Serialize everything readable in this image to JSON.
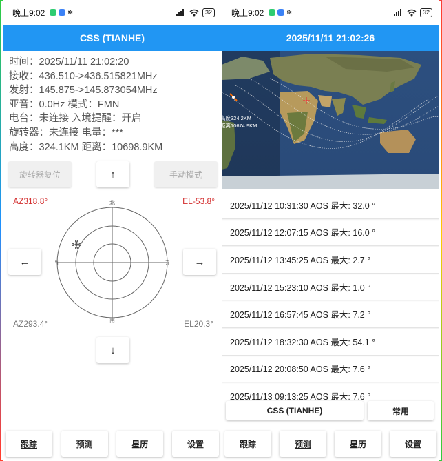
{
  "status": {
    "time": "晚上9:02",
    "battery": "32",
    "bluetooth": "✻",
    "signal_icon": "signal-icon",
    "wifi_icon": "wifi-icon"
  },
  "left": {
    "title": "CSS (TIANHE)",
    "info": [
      "时间：2025/11/11 21:02:20",
      "接收：436.510->436.515821MHz",
      "发射：145.875->145.873054MHz",
      "亚音：0.0Hz  模式：FMN",
      "电台：未连接  入境提醒：开启",
      "旋转器：未连接  电量：***",
      "高度：324.1KM  距离：10698.9KM"
    ],
    "rotator_reset": "旋转器复位",
    "up_arrow": "↑",
    "manual_mode": "手动模式",
    "az_current": "AZ318.8°",
    "el_current": "EL-53.8°",
    "left_arrow": "←",
    "right_arrow": "→",
    "down_arrow": "↓",
    "az_target": "AZ293.4°",
    "el_target": "EL20.3°",
    "compass": {
      "north": "北",
      "south": "南",
      "east": "东",
      "west": "西"
    },
    "sat_marker": "卫星"
  },
  "right": {
    "title": "2025/11/11 21:02:26",
    "map_label_height": "高度324.2KM",
    "map_label_distance": "距离10674.9KM",
    "passes": [
      "2025/11/12 10:31:30 AOS 最大:  32.0 °",
      "2025/11/12 12:07:15 AOS 最大:  16.0 °",
      "2025/11/12 13:45:25 AOS 最大:  2.7 °",
      "2025/11/12 15:23:10 AOS 最大:  1.0 °",
      "2025/11/12 16:57:45 AOS 最大:  7.2 °",
      "2025/11/12 18:32:30 AOS 最大:  54.1 °",
      "2025/11/12 20:08:50 AOS 最大:  7.6 °",
      "2025/11/13 09:13:25 AOS 最大:  7.6 °"
    ],
    "satellite_button": "CSS (TIANHE)",
    "favorite_button": "常用"
  },
  "nav": [
    "跟踪",
    "预测",
    "星历",
    "设置"
  ],
  "colors": {
    "accent": "#2196f3",
    "warning": "#d32f2f"
  }
}
